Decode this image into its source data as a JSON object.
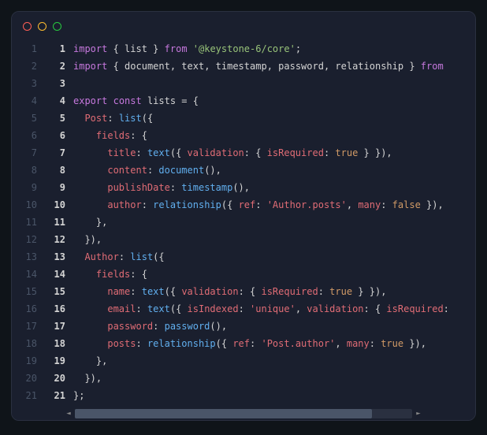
{
  "lines": [
    {
      "outer": "1",
      "inner": "1",
      "tokens": [
        [
          "kw",
          "import"
        ],
        [
          "pn",
          " { "
        ],
        [
          "id",
          "list"
        ],
        [
          "pn",
          " } "
        ],
        [
          "kw",
          "from"
        ],
        [
          "pn",
          " "
        ],
        [
          "st",
          "'@keystone-6/core'"
        ],
        [
          "pn",
          ";"
        ]
      ]
    },
    {
      "outer": "2",
      "inner": "2",
      "tokens": [
        [
          "kw",
          "import"
        ],
        [
          "pn",
          " { "
        ],
        [
          "id",
          "document"
        ],
        [
          "pn",
          ", "
        ],
        [
          "id",
          "text"
        ],
        [
          "pn",
          ", "
        ],
        [
          "id",
          "timestamp"
        ],
        [
          "pn",
          ", "
        ],
        [
          "id",
          "password"
        ],
        [
          "pn",
          ", "
        ],
        [
          "id",
          "relationship"
        ],
        [
          "pn",
          " } "
        ],
        [
          "kw",
          "from"
        ]
      ]
    },
    {
      "outer": "3",
      "inner": "3",
      "tokens": []
    },
    {
      "outer": "4",
      "inner": "4",
      "tokens": [
        [
          "kw",
          "export"
        ],
        [
          "pn",
          " "
        ],
        [
          "kw",
          "const"
        ],
        [
          "pn",
          " "
        ],
        [
          "id",
          "lists"
        ],
        [
          "pn",
          " = {"
        ]
      ]
    },
    {
      "outer": "5",
      "inner": "5",
      "tokens": [
        [
          "pn",
          "  "
        ],
        [
          "pr",
          "Post"
        ],
        [
          "pn",
          ": "
        ],
        [
          "fn",
          "list"
        ],
        [
          "pn",
          "({"
        ]
      ]
    },
    {
      "outer": "6",
      "inner": "6",
      "tokens": [
        [
          "pn",
          "    "
        ],
        [
          "pr",
          "fields"
        ],
        [
          "pn",
          ": {"
        ]
      ]
    },
    {
      "outer": "7",
      "inner": "7",
      "tokens": [
        [
          "pn",
          "      "
        ],
        [
          "pr",
          "title"
        ],
        [
          "pn",
          ": "
        ],
        [
          "fn",
          "text"
        ],
        [
          "pn",
          "({ "
        ],
        [
          "pr",
          "validation"
        ],
        [
          "pn",
          ": { "
        ],
        [
          "pr",
          "isRequired"
        ],
        [
          "pn",
          ": "
        ],
        [
          "bl",
          "true"
        ],
        [
          "pn",
          " } }),"
        ]
      ]
    },
    {
      "outer": "8",
      "inner": "8",
      "tokens": [
        [
          "pn",
          "      "
        ],
        [
          "pr",
          "content"
        ],
        [
          "pn",
          ": "
        ],
        [
          "fn",
          "document"
        ],
        [
          "pn",
          "(),"
        ]
      ]
    },
    {
      "outer": "9",
      "inner": "9",
      "tokens": [
        [
          "pn",
          "      "
        ],
        [
          "pr",
          "publishDate"
        ],
        [
          "pn",
          ": "
        ],
        [
          "fn",
          "timestamp"
        ],
        [
          "pn",
          "(),"
        ]
      ]
    },
    {
      "outer": "10",
      "inner": "10",
      "tokens": [
        [
          "pn",
          "      "
        ],
        [
          "pr",
          "author"
        ],
        [
          "pn",
          ": "
        ],
        [
          "fn",
          "relationship"
        ],
        [
          "pn",
          "({ "
        ],
        [
          "pr",
          "ref"
        ],
        [
          "pn",
          ": "
        ],
        [
          "sr",
          "'Author.posts'"
        ],
        [
          "pn",
          ", "
        ],
        [
          "pr",
          "many"
        ],
        [
          "pn",
          ": "
        ],
        [
          "bl",
          "false"
        ],
        [
          "pn",
          " }),"
        ]
      ]
    },
    {
      "outer": "11",
      "inner": "11",
      "tokens": [
        [
          "pn",
          "    },"
        ]
      ]
    },
    {
      "outer": "12",
      "inner": "12",
      "tokens": [
        [
          "pn",
          "  }),"
        ]
      ]
    },
    {
      "outer": "13",
      "inner": "13",
      "tokens": [
        [
          "pn",
          "  "
        ],
        [
          "pr",
          "Author"
        ],
        [
          "pn",
          ": "
        ],
        [
          "fn",
          "list"
        ],
        [
          "pn",
          "({"
        ]
      ]
    },
    {
      "outer": "14",
      "inner": "14",
      "tokens": [
        [
          "pn",
          "    "
        ],
        [
          "pr",
          "fields"
        ],
        [
          "pn",
          ": {"
        ]
      ]
    },
    {
      "outer": "15",
      "inner": "15",
      "tokens": [
        [
          "pn",
          "      "
        ],
        [
          "pr",
          "name"
        ],
        [
          "pn",
          ": "
        ],
        [
          "fn",
          "text"
        ],
        [
          "pn",
          "({ "
        ],
        [
          "pr",
          "validation"
        ],
        [
          "pn",
          ": { "
        ],
        [
          "pr",
          "isRequired"
        ],
        [
          "pn",
          ": "
        ],
        [
          "bl",
          "true"
        ],
        [
          "pn",
          " } }),"
        ]
      ]
    },
    {
      "outer": "16",
      "inner": "16",
      "tokens": [
        [
          "pn",
          "      "
        ],
        [
          "pr",
          "email"
        ],
        [
          "pn",
          ": "
        ],
        [
          "fn",
          "text"
        ],
        [
          "pn",
          "({ "
        ],
        [
          "pr",
          "isIndexed"
        ],
        [
          "pn",
          ": "
        ],
        [
          "sr",
          "'unique'"
        ],
        [
          "pn",
          ", "
        ],
        [
          "pr",
          "validation"
        ],
        [
          "pn",
          ": { "
        ],
        [
          "pr",
          "isRequired"
        ],
        [
          "pn",
          ":"
        ]
      ]
    },
    {
      "outer": "17",
      "inner": "17",
      "tokens": [
        [
          "pn",
          "      "
        ],
        [
          "pr",
          "password"
        ],
        [
          "pn",
          ": "
        ],
        [
          "fn",
          "password"
        ],
        [
          "pn",
          "(),"
        ]
      ]
    },
    {
      "outer": "18",
      "inner": "18",
      "tokens": [
        [
          "pn",
          "      "
        ],
        [
          "pr",
          "posts"
        ],
        [
          "pn",
          ": "
        ],
        [
          "fn",
          "relationship"
        ],
        [
          "pn",
          "({ "
        ],
        [
          "pr",
          "ref"
        ],
        [
          "pn",
          ": "
        ],
        [
          "sr",
          "'Post.author'"
        ],
        [
          "pn",
          ", "
        ],
        [
          "pr",
          "many"
        ],
        [
          "pn",
          ": "
        ],
        [
          "bl",
          "true"
        ],
        [
          "pn",
          " }),"
        ]
      ]
    },
    {
      "outer": "19",
      "inner": "19",
      "tokens": [
        [
          "pn",
          "    },"
        ]
      ]
    },
    {
      "outer": "20",
      "inner": "20",
      "tokens": [
        [
          "pn",
          "  }),"
        ]
      ]
    },
    {
      "outer": "21",
      "inner": "21",
      "tokens": [
        [
          "pn",
          "};"
        ]
      ]
    }
  ]
}
